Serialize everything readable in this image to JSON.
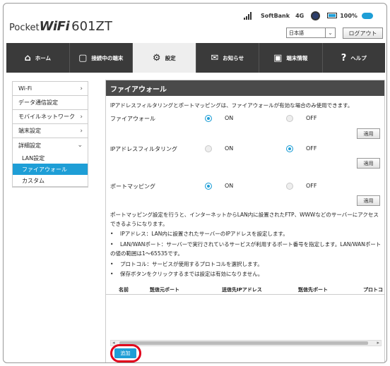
{
  "header": {
    "brand_prefix": "Pocket",
    "brand_wifi": "WiFi",
    "brand_model": "601ZT",
    "carrier": "SoftBank",
    "network": "4G",
    "battery": "100%",
    "battery_level": 1.0,
    "language": "日本語",
    "logout_label": "ログアウト"
  },
  "nav": {
    "tabs": [
      {
        "label": "ホーム",
        "icon": "home-icon"
      },
      {
        "label": "接続中の端末",
        "icon": "devices-icon"
      },
      {
        "label": "設定",
        "icon": "gear-icon",
        "active": true
      },
      {
        "label": "お知らせ",
        "icon": "mail-icon"
      },
      {
        "label": "端末情報",
        "icon": "device-info-icon"
      },
      {
        "label": "ヘルプ",
        "icon": "help-icon"
      }
    ]
  },
  "sidebar": {
    "items": [
      {
        "label": "Wi-Fi"
      },
      {
        "label": "データ通信設定"
      },
      {
        "label": "モバイルネットワーク"
      },
      {
        "label": "端末設定"
      }
    ],
    "advanced": {
      "label": "詳細設定",
      "subitems": [
        {
          "label": "LAN設定"
        },
        {
          "label": "ファイアウォール",
          "active": true
        },
        {
          "label": "カスタム"
        }
      ]
    }
  },
  "main": {
    "title": "ファイアウォール",
    "intro": "IPアドレスフィルタリングとポートマッピングは、ファイアウォールが有効な場合のみ使用できます。",
    "on_label": "ON",
    "off_label": "OFF",
    "apply_label": "適用",
    "settings": [
      {
        "label": "ファイアウォール",
        "value": "ON"
      },
      {
        "label": "IPアドレスフィルタリング",
        "value": "OFF"
      },
      {
        "label": "ポートマッピング",
        "value": "ON"
      }
    ],
    "note": "ポートマッピング設定を行うと、インターネットからLAN内に設置されたFTP、WWWなどのサーバーにアクセスできるようになります。",
    "bullets": [
      "IPアドレス：LAN内に設置されたサーバーのIPアドレスを設定します。",
      "LAN/WANポート：サーバーで実行されているサービスが利用するポート番号を指定します。LAN/WANポートの値の範囲は1～65535です。",
      "プロトコル：サービスが使用するプロトコルを選択します。",
      "保存ボタンをクリックするまでは設定は有効になりません。"
    ],
    "table_headers": [
      "名前",
      "送信元ポート",
      "送信先IPアドレス",
      "送信先ポート",
      "プロトコ"
    ],
    "required_mark": "*",
    "add_label": "追加"
  }
}
